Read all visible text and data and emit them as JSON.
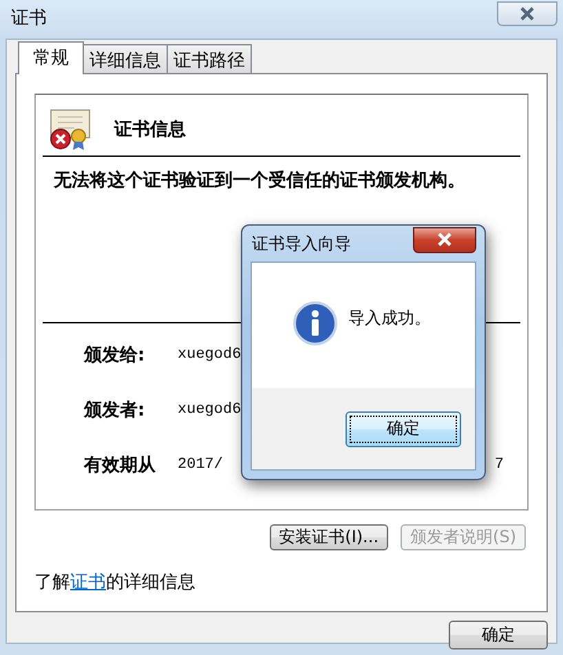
{
  "window": {
    "title": "证书"
  },
  "tabs": [
    {
      "label": "常规",
      "selected": true
    },
    {
      "label": "详细信息",
      "selected": false
    },
    {
      "label": "证书路径",
      "selected": false
    }
  ],
  "cert_info": {
    "heading": "证书信息",
    "warning": "无法将这个证书验证到一个受信任的证书颁发机构。",
    "fields": [
      {
        "label": "颁发给:",
        "value": "xuegod6"
      },
      {
        "label": "颁发者:",
        "value": "xuegod6"
      },
      {
        "label": "有效期从",
        "value": "2017/",
        "value_end": "7"
      }
    ]
  },
  "buttons": [
    {
      "label": "安装证书(I)...",
      "disabled": false
    },
    {
      "label": "颁发者说明(S)",
      "disabled": true
    }
  ],
  "learn_more": {
    "before": "了解",
    "link": "证书",
    "after": "的详细信息"
  },
  "ok_button": "确定",
  "dialog": {
    "title": "证书导入向导",
    "message": "导入成功。",
    "button": "确定"
  }
}
